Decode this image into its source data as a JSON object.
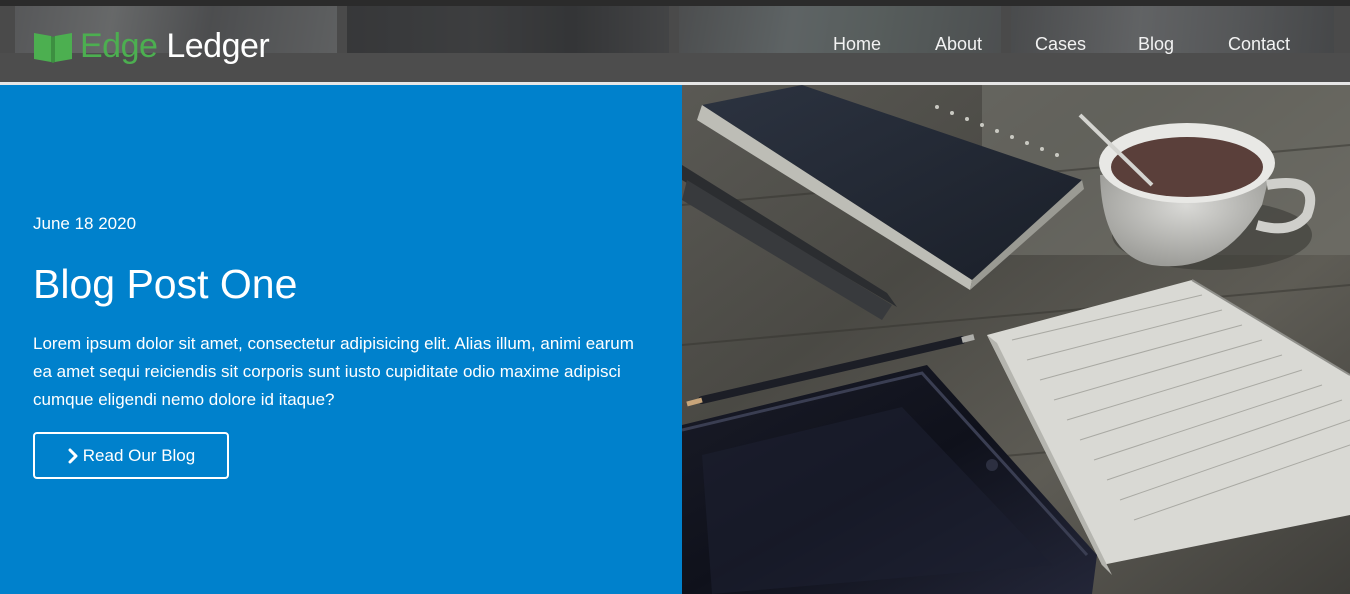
{
  "brand": {
    "part1": "Edge",
    "part2": "Ledger",
    "icon": "open-book-icon",
    "accent_color": "#4caf50"
  },
  "nav": {
    "items": [
      {
        "label": "Home"
      },
      {
        "label": "About"
      },
      {
        "label": "Cases"
      },
      {
        "label": "Blog"
      },
      {
        "label": "Contact"
      }
    ]
  },
  "post": {
    "date": "June 18 2020",
    "title": "Blog Post One",
    "excerpt": "Lorem ipsum dolor sit amet, consectetur adipisicing elit. Alias illum, animi earum ea amet sequi reiciendis sit corporis sunt iusto cupiditate odio maxime adipisci cumque eligendi nemo dolore id itaque?",
    "cta_label": "Read Our Blog",
    "cta_icon": "chevron-right-icon",
    "panel_color": "#0081cc"
  },
  "photo": {
    "icon": "desk-notebooks-coffee-photo"
  }
}
